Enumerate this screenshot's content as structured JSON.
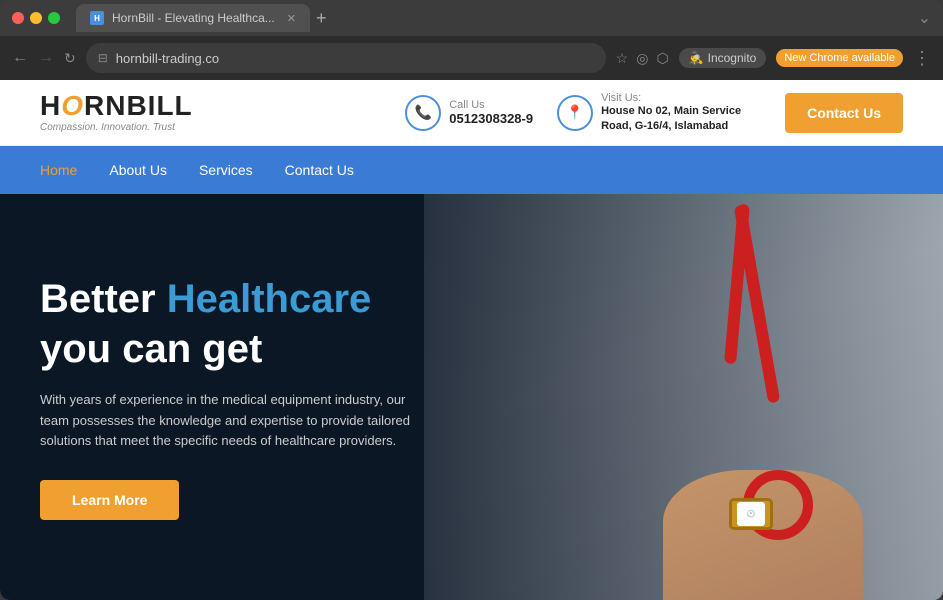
{
  "browser": {
    "tab_title": "HornBill - Elevating Healthca...",
    "url": "hornbill-trading.co",
    "back_btn": "←",
    "forward_btn": "→",
    "reload_btn": "↺",
    "incognito_label": "Incognito",
    "chrome_badge": "New Chrome available",
    "new_tab_btn": "+"
  },
  "header": {
    "logo_text_horn": "HORN",
    "logo_text_bill": "BILL",
    "logo_tagline": "Compassion. Innovation. Trust",
    "call_label": "Call Us",
    "call_number": "0512308328-9",
    "visit_label": "Visit Us:",
    "visit_address": "House No 02, Main Service Road, G-16/4, Islamabad",
    "contact_btn": "Contact Us"
  },
  "nav": {
    "items": [
      {
        "label": "Home",
        "active": true
      },
      {
        "label": "About Us",
        "active": false
      },
      {
        "label": "Services",
        "active": false
      },
      {
        "label": "Contact Us",
        "active": false
      }
    ]
  },
  "hero": {
    "title_part1": "Better ",
    "title_highlight": "Healthcare",
    "title_part2": "you can get",
    "description": "With years of experience in the medical equipment industry, our team possesses the knowledge and expertise to provide tailored solutions that meet the specific needs of healthcare providers.",
    "learn_btn": "Learn More"
  }
}
